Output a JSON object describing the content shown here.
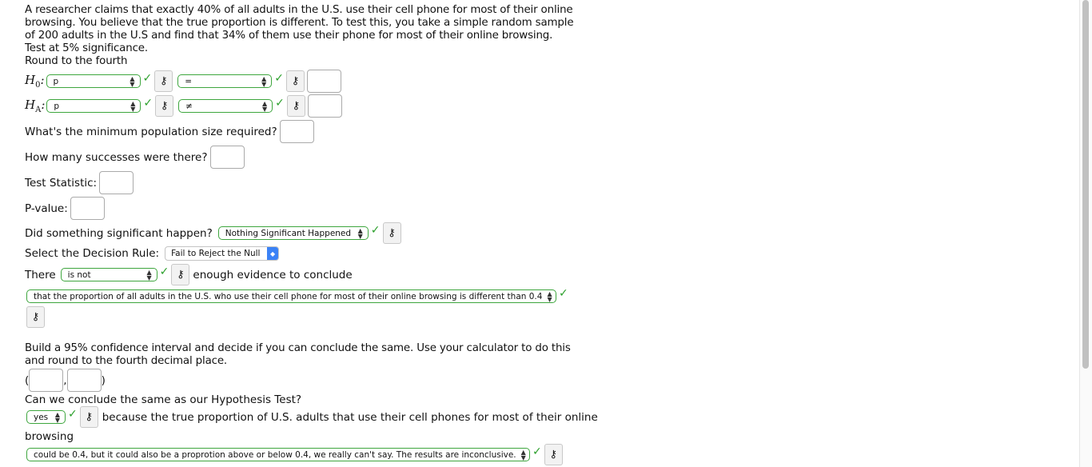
{
  "problem": {
    "text": "A researcher claims that exactly 40% of all adults in the U.S. use their cell phone for most of their online browsing. You believe that the true proportion is different. To test this, you take a simple random sample of 200 adults in the U.S and find that 34% of them use their phone for most of their online browsing. Test at 5% significance.",
    "rounding": "Round to the fourth"
  },
  "h0": {
    "label": "H",
    "sub": "0",
    "param": "p",
    "op": "=",
    "value": ""
  },
  "ha": {
    "label": "H",
    "sub": "A",
    "param": "p",
    "op": "≠",
    "value": ""
  },
  "questions": {
    "min_population": "What's the minimum population size required?",
    "successes": "How many successes were there?",
    "test_statistic": "Test Statistic:",
    "p_value": "P-value:",
    "significant": "Did something significant happen?",
    "significant_value": "Nothing Significant Happened",
    "decision_rule": "Select the Decision Rule:",
    "decision_value": "Fail to Reject the Null",
    "there": "There",
    "there_value": "is not",
    "enough": "enough evidence to conclude",
    "conclusion_value": "that the proportion of all adults in the U.S. who use their cell phone for most of their online browsing is different than 0.4"
  },
  "ci": {
    "prompt": "Build a 95% confidence interval and decide if you can conclude the same. Use your calculator to do this and round to the fourth decimal place.",
    "open": "(",
    "comma": ",",
    "close": ")",
    "same_question": "Can we conclude the same as our Hypothesis Test?",
    "same_value": "yes",
    "because": "because the true proportion of U.S. adults that use their cell phones for most of their online",
    "browsing": "browsing",
    "reason_value": "could be 0.4, but it could also be a proprotion above or below 0.4, we really can't say. The results are inconclusive."
  },
  "icons": {
    "key": "⚷",
    "check": "✓",
    "updown": "⬍"
  },
  "colors": {
    "correct_border": "#3ea63e",
    "check": "#2ca02c",
    "select_blue": "#3b82f6"
  }
}
